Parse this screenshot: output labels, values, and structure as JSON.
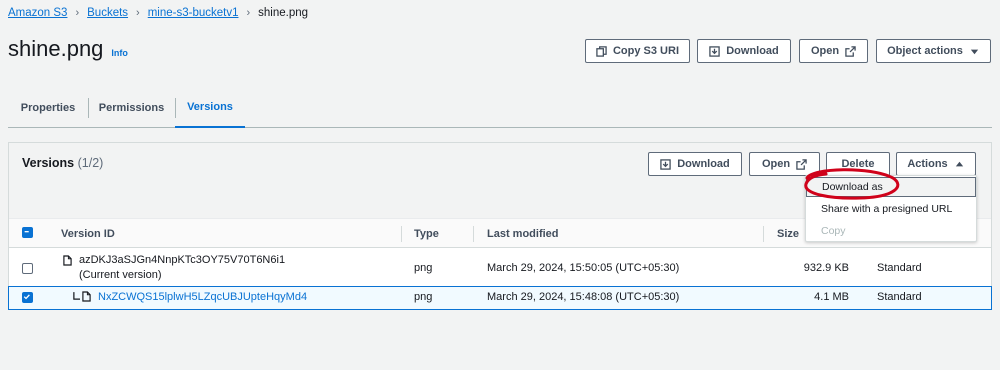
{
  "breadcrumb": {
    "items": [
      "Amazon S3",
      "Buckets",
      "mine-s3-bucketv1"
    ],
    "current": "shine.png"
  },
  "page": {
    "title": "shine.png",
    "info_label": "Info"
  },
  "header_actions": {
    "copy_uri": "Copy S3 URI",
    "download": "Download",
    "open": "Open",
    "object_actions": "Object actions"
  },
  "tabs": [
    {
      "label": "Properties",
      "active": false
    },
    {
      "label": "Permissions",
      "active": false
    },
    {
      "label": "Versions",
      "active": true
    }
  ],
  "versions": {
    "title": "Versions",
    "count": "(1/2)",
    "buttons": {
      "download": "Download",
      "open": "Open",
      "delete": "Delete",
      "actions": "Actions"
    },
    "columns": {
      "version_id": "Version ID",
      "type": "Type",
      "last_modified": "Last modified",
      "size": "Size",
      "storage_class": ""
    },
    "rows": [
      {
        "version_id": "azDKJ3aSJGn4NnpKTc3OY75V70T6N6i1",
        "note": "(Current version)",
        "type": "png",
        "last_modified": "March 29, 2024, 15:50:05 (UTC+05:30)",
        "size": "932.9 KB",
        "storage_class": "Standard",
        "selected": false
      },
      {
        "version_id": "NxZCWQS15lplwH5LZqcUBJUpteHqyMd4",
        "note": "",
        "type": "png",
        "last_modified": "March 29, 2024, 15:48:08 (UTC+05:30)",
        "size": "4.1 MB",
        "storage_class": "Standard",
        "selected": true
      }
    ]
  },
  "actions_menu": {
    "items": [
      {
        "label": "Download as",
        "highlighted": true,
        "disabled": false
      },
      {
        "label": "Share with a presigned URL",
        "highlighted": false,
        "disabled": false
      },
      {
        "label": "Copy",
        "highlighted": false,
        "disabled": true
      }
    ]
  },
  "colors": {
    "link": "#0972d3",
    "text": "#16191f",
    "border": "#5f6b7a",
    "annotation": "#d0021b"
  }
}
